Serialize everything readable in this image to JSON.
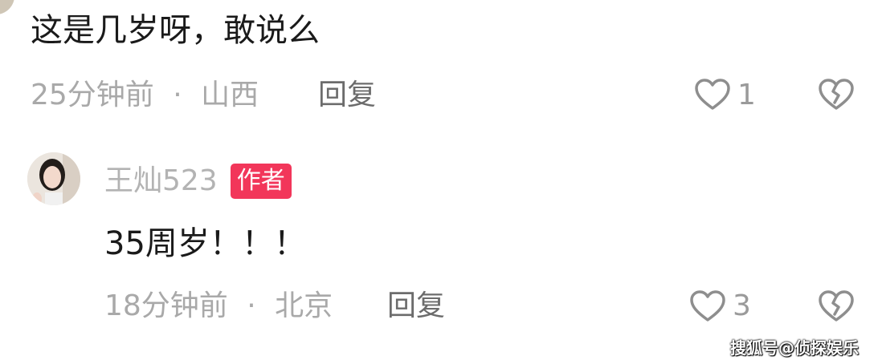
{
  "comments": [
    {
      "text": "这是几岁呀，敢说么",
      "time": "25分钟前",
      "separator": "·",
      "location": "山西",
      "reply_label": "回复",
      "like_count": "1"
    },
    {
      "username": "王灿523",
      "badge": "作者",
      "text": "35周岁！！！",
      "time": "18分钟前",
      "separator": "·",
      "location": "北京",
      "reply_label": "回复",
      "like_count": "3"
    }
  ],
  "icons": {
    "like": "heart-outline-icon",
    "dislike": "broken-heart-icon"
  },
  "colors": {
    "badge_bg": "#f2365a",
    "meta_text": "#a9a9a9",
    "body_text": "#1a1a1a"
  },
  "watermark": "搜狐号@侦探娱乐"
}
